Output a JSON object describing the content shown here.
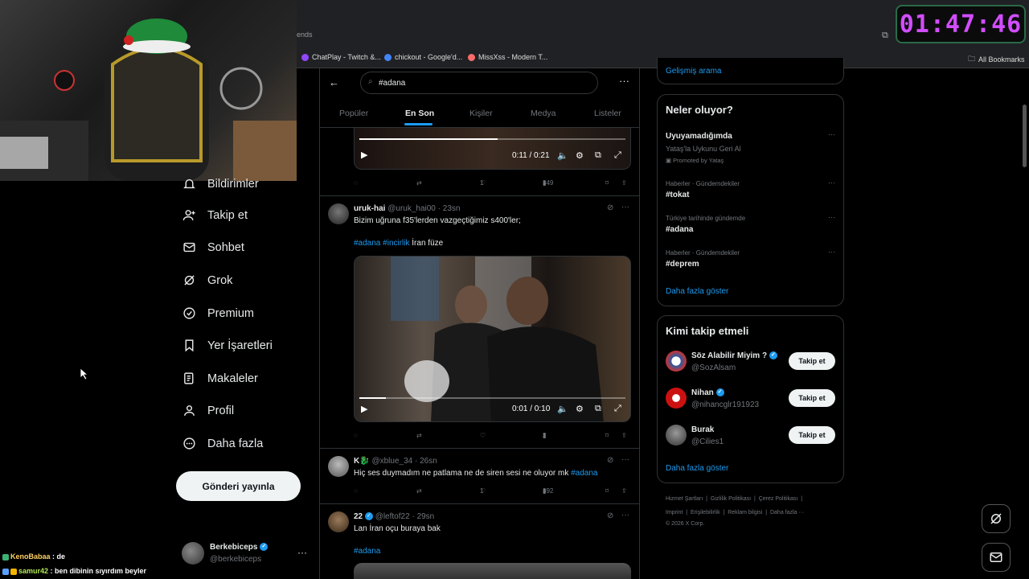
{
  "timer": "01:47:46",
  "browser": {
    "partial_tab": "ends",
    "bookmarks": [
      {
        "label": "ChatPlay - Twitch &...",
        "color": "#9146ff"
      },
      {
        "label": "chickout - Google'd...",
        "color": "#4285f4"
      },
      {
        "label": "MissXss - Modern T...",
        "color": "#ff6b6b"
      }
    ],
    "all_bookmarks": "All Bookmarks"
  },
  "nav": {
    "items": [
      {
        "label": "Bildirimler"
      },
      {
        "label": "Takip et"
      },
      {
        "label": "Sohbet"
      },
      {
        "label": "Grok"
      },
      {
        "label": "Premium"
      },
      {
        "label": "Yer İşaretleri"
      },
      {
        "label": "Makaleler"
      },
      {
        "label": "Profil"
      },
      {
        "label": "Daha fazla"
      }
    ],
    "post_button": "Gönderi yayınla",
    "account": {
      "name": "Berkebiceps",
      "handle": "@berkebiceps"
    }
  },
  "search": {
    "query": "#adana"
  },
  "tabs": [
    "Popüler",
    "En Son",
    "Kişiler",
    "Medya",
    "Listeler"
  ],
  "tweets": [
    {
      "video": {
        "time": "0:11 / 0:21",
        "progress": 0.52
      },
      "actions": {
        "likes": "1",
        "views": "349"
      }
    },
    {
      "name": "uruk-hai",
      "handle": "@uruk_hai00",
      "time": "23sn",
      "text": "Bizim uğruna f35'lerden vazgeçtiğimiz s400'ler;",
      "hashtags": [
        "#adana",
        "#incirlik"
      ],
      "tail": "İran füze",
      "video": {
        "time": "0:01 / 0:10",
        "progress": 0.1
      },
      "actions": {
        "likes": "",
        "views": "2"
      }
    },
    {
      "name": "K🐉",
      "handle": "@xblue_34",
      "time": "26sn",
      "text": "Hiç ses duymadım ne patlama ne de siren sesi ne oluyor mk",
      "hashtag": "#adana",
      "actions": {
        "likes": "1",
        "views": "392"
      }
    },
    {
      "name": "22",
      "handle": "@leftof22",
      "time": "29sn",
      "text": "Lan İran oçu buraya bak",
      "hashtag": "#adana"
    }
  ],
  "right": {
    "advanced_search": "Gelişmiş arama",
    "trends_title": "Neler oluyor?",
    "promo": {
      "title": "Uyuyamadığımda",
      "subtitle": "Yataş'la Uykunu Geri Al",
      "promoted": "Promoted by Yataş"
    },
    "trends": [
      {
        "category": "Haberler · Gündemdekiler",
        "name": "#tokat"
      },
      {
        "category": "Türkiye tarihinde gündemde",
        "name": "#adana"
      },
      {
        "category": "Haberler · Gündemdekiler",
        "name": "#deprem"
      }
    ],
    "show_more": "Daha fazla göster",
    "follow_title": "Kimi takip etmeli",
    "suggestions": [
      {
        "name": "Söz Alabilir Miyim ?",
        "handle": "@SozAlsam"
      },
      {
        "name": "Nihan",
        "handle": "@nihancglr191923"
      },
      {
        "name": "Burak",
        "handle": "@Cilies1"
      }
    ],
    "follow_label": "Takip et",
    "show_more2": "Daha fazla göster",
    "footer": {
      "line1": [
        "Hizmet Şartları",
        "Gizlilik Politikası",
        "Çerez Politikası"
      ],
      "line2": [
        "Imprint",
        "Erişilebilirlik",
        "Reklam bilgisi",
        "Daha fazla ···"
      ],
      "copyright": "© 2026 X Corp."
    }
  },
  "chat": [
    {
      "user": "KenoBabaa",
      "msg": " : de",
      "color": "#ffd166"
    },
    {
      "user": "samur42",
      "msg": " : ben dibinin sıyırdım beyler",
      "color": "#b5e853"
    }
  ]
}
